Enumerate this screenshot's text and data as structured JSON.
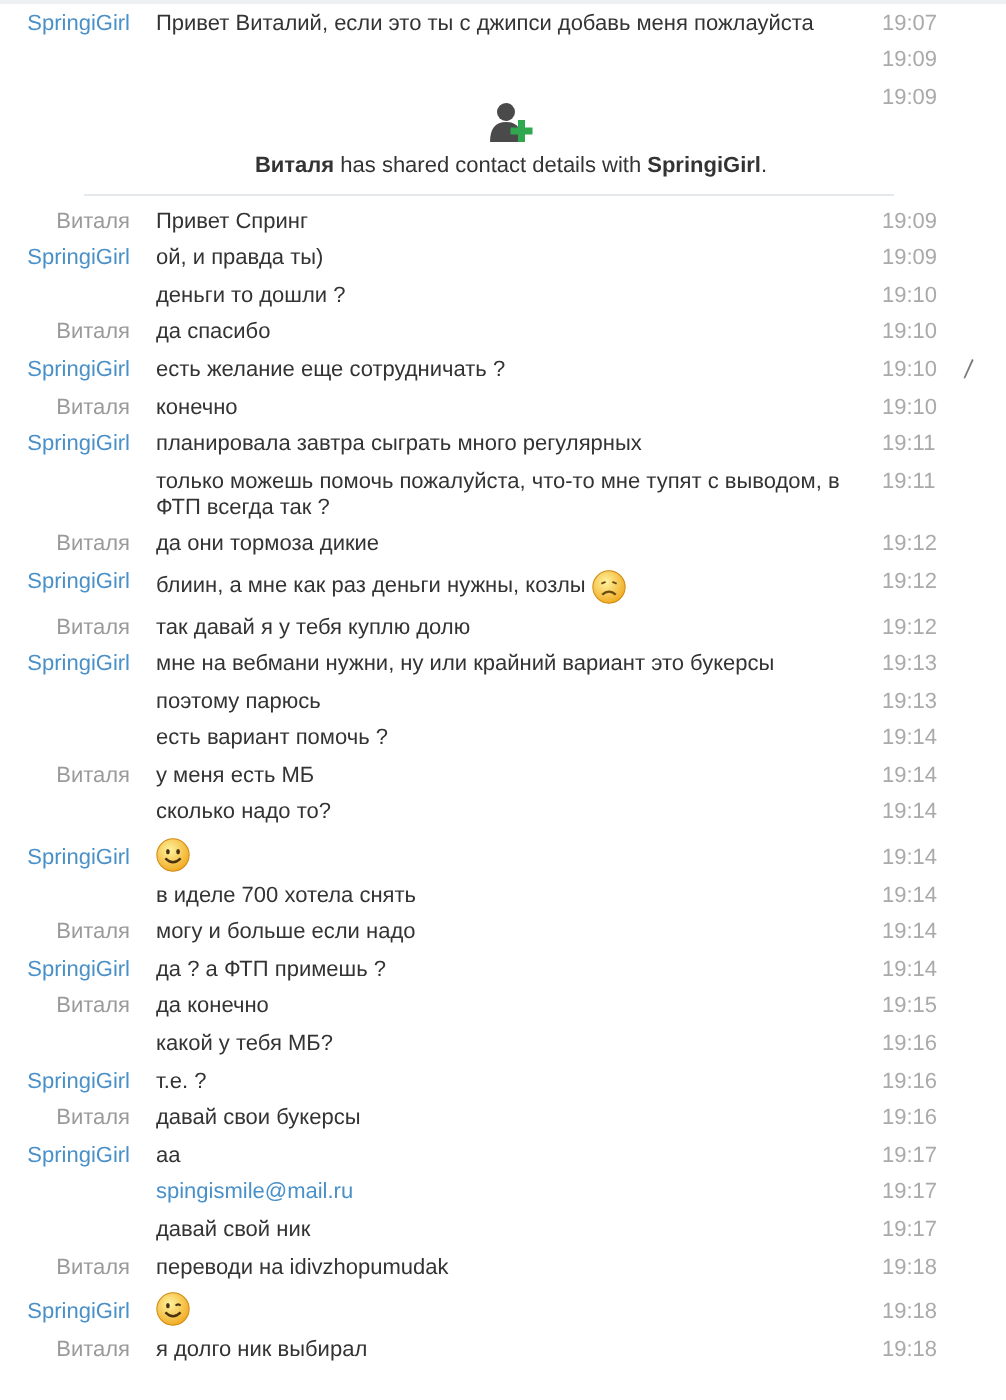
{
  "messages": [
    {
      "kind": "text",
      "sender": "SpringiGirl",
      "color": "#4a90c8",
      "text": "Привет Виталий, если это ты с джипси добавь меня пожлауйста",
      "time": "19:07"
    },
    {
      "kind": "blank",
      "time": "19:09"
    },
    {
      "kind": "system",
      "text": "**Виталя** has shared contact details with **SpringiGirl**.",
      "time": "19:09"
    },
    {
      "kind": "text",
      "sender": "Виталя",
      "color": "#9a9a9a",
      "text": "Привет Спринг",
      "time": "19:09"
    },
    {
      "kind": "text",
      "sender": "SpringiGirl",
      "color": "#4a90c8",
      "text": "ой, и правда ты)",
      "time": "19:09"
    },
    {
      "kind": "text",
      "text": "деньги то дошли ?",
      "time": "19:10"
    },
    {
      "kind": "text",
      "sender": "Виталя",
      "color": "#9a9a9a",
      "text": "да спасибо",
      "time": "19:10"
    },
    {
      "kind": "text",
      "sender": "SpringiGirl",
      "color": "#4a90c8",
      "text": "есть желание еще сотрудничать ?",
      "time": "19:10",
      "edited": true
    },
    {
      "kind": "text",
      "sender": "Виталя",
      "color": "#9a9a9a",
      "text": "конечно",
      "time": "19:10"
    },
    {
      "kind": "text",
      "sender": "SpringiGirl",
      "color": "#4a90c8",
      "text": "планировала завтра сыграть много регулярных",
      "time": "19:11"
    },
    {
      "kind": "text",
      "text": "только можешь помочь пожалуйста, что-то мне тупят с выводом, в ФТП всегда так ?",
      "time": "19:11"
    },
    {
      "kind": "text",
      "sender": "Виталя",
      "color": "#9a9a9a",
      "text": "да они тормоза дикие",
      "time": "19:12"
    },
    {
      "kind": "sad",
      "sender": "SpringiGirl",
      "color": "#4a90c8",
      "text": "блиин, а мне как раз деньги нужны, козлы",
      "time": "19:12"
    },
    {
      "kind": "text",
      "sender": "Виталя",
      "color": "#9a9a9a",
      "text": "так давай я у тебя куплю долю",
      "time": "19:12"
    },
    {
      "kind": "text",
      "sender": "SpringiGirl",
      "color": "#4a90c8",
      "text": "мне на вебмани нужни, ну или крайний вариант это букерсы",
      "time": "19:13"
    },
    {
      "kind": "text",
      "text": "поэтому парюсь",
      "time": "19:13"
    },
    {
      "kind": "text",
      "text": "есть вариант помочь ?",
      "time": "19:14"
    },
    {
      "kind": "text",
      "sender": "Виталя",
      "color": "#9a9a9a",
      "text": "у меня есть МБ",
      "time": "19:14"
    },
    {
      "kind": "text",
      "text": "сколько надо то?",
      "time": "19:14"
    },
    {
      "kind": "smile",
      "sender": "SpringiGirl",
      "color": "#4a90c8",
      "time": "19:14"
    },
    {
      "kind": "text",
      "text": "в иделе 700 хотела снять",
      "time": "19:14"
    },
    {
      "kind": "text",
      "sender": "Виталя",
      "color": "#9a9a9a",
      "text": "могу и больше если надо",
      "time": "19:14"
    },
    {
      "kind": "text",
      "sender": "SpringiGirl",
      "color": "#4a90c8",
      "text": "да ? а ФТП примешь ?",
      "time": "19:14"
    },
    {
      "kind": "text",
      "sender": "Виталя",
      "color": "#9a9a9a",
      "text": "да конечно",
      "time": "19:15"
    },
    {
      "kind": "text",
      "text": "какой у тебя МБ?",
      "time": "19:16"
    },
    {
      "kind": "text",
      "sender": "SpringiGirl",
      "color": "#4a90c8",
      "text": "т.е. ?",
      "time": "19:16"
    },
    {
      "kind": "text",
      "sender": "Виталя",
      "color": "#9a9a9a",
      "text": "давай свои букерсы",
      "time": "19:16"
    },
    {
      "kind": "text",
      "sender": "SpringiGirl",
      "color": "#4a90c8",
      "text": "аа",
      "time": "19:17"
    },
    {
      "kind": "link",
      "text": "spingismile@mail.ru",
      "time": "19:17"
    },
    {
      "kind": "text",
      "text": "давай свой ник",
      "time": "19:17"
    },
    {
      "kind": "text",
      "sender": "Виталя",
      "color": "#9a9a9a",
      "text": "переводи на idivzhopumudak",
      "time": "19:18"
    },
    {
      "kind": "wink",
      "sender": "SpringiGirl",
      "color": "#4a90c8",
      "time": "19:18"
    },
    {
      "kind": "text",
      "sender": "Виталя",
      "color": "#9a9a9a",
      "text": "я долго ник выбирал",
      "time": "19:18"
    }
  ]
}
